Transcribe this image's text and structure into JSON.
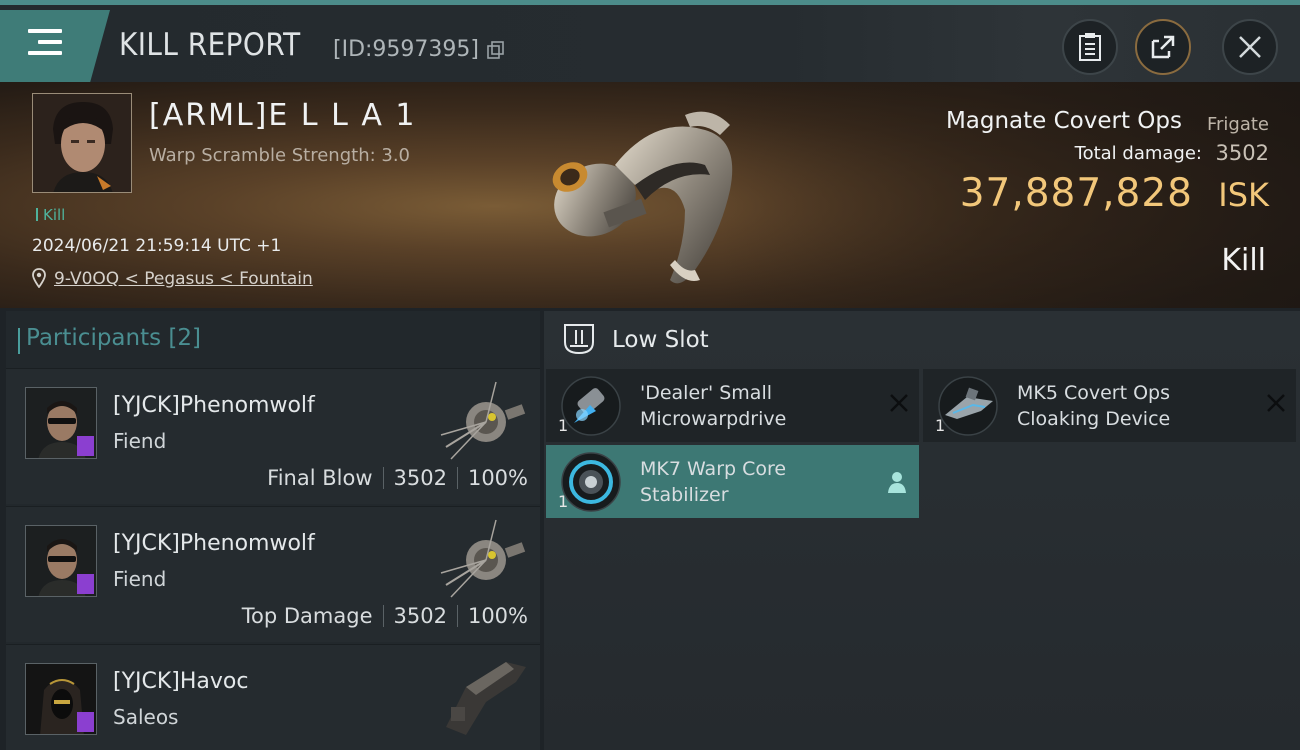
{
  "header": {
    "title": "KILL REPORT",
    "id_text": "[ID:9597395]"
  },
  "victim": {
    "name": "[ARML]E L L A 1",
    "warp_scramble": "Warp Scramble Strength: 3.0",
    "tag": "Kill",
    "datetime": "2024/06/21 21:59:14 UTC +1",
    "location": "9-V0OQ < Pegasus < Fountain",
    "ship_name": "Magnate Covert Ops",
    "ship_class": "Frigate",
    "total_damage_label": "Total damage:",
    "total_damage": "3502",
    "isk_value": "37,887,828",
    "isk_unit": "ISK",
    "report_type": "Kill"
  },
  "participants": {
    "title": "Participants",
    "count": "[2]",
    "rows": [
      {
        "name": "[YJCK]Phenomwolf",
        "ship": "Fiend",
        "role": "Final Blow",
        "damage": "3502",
        "percent": "100%"
      },
      {
        "name": "[YJCK]Phenomwolf",
        "ship": "Fiend",
        "role": "Top Damage",
        "damage": "3502",
        "percent": "100%"
      },
      {
        "name": "[YJCK]Havoc",
        "ship": "Saleos"
      }
    ]
  },
  "low_slot": {
    "title": "Low Slot",
    "items": [
      {
        "name_line1": "'Dealer' Small",
        "name_line2": "Microwarpdrive",
        "qty": "1",
        "status": "destroyed"
      },
      {
        "name_line1": "MK5 Covert Ops",
        "name_line2": "Cloaking Device",
        "qty": "1",
        "status": "destroyed"
      },
      {
        "name_line1": "MK7 Warp Core",
        "name_line2": "Stabilizer",
        "qty": "1",
        "status": "dropped"
      }
    ]
  },
  "colors": {
    "accent": "#3f7c78",
    "isk": "#f2c77a",
    "kill_tag": "#4fb39c",
    "badge": "#8b3fd0"
  }
}
